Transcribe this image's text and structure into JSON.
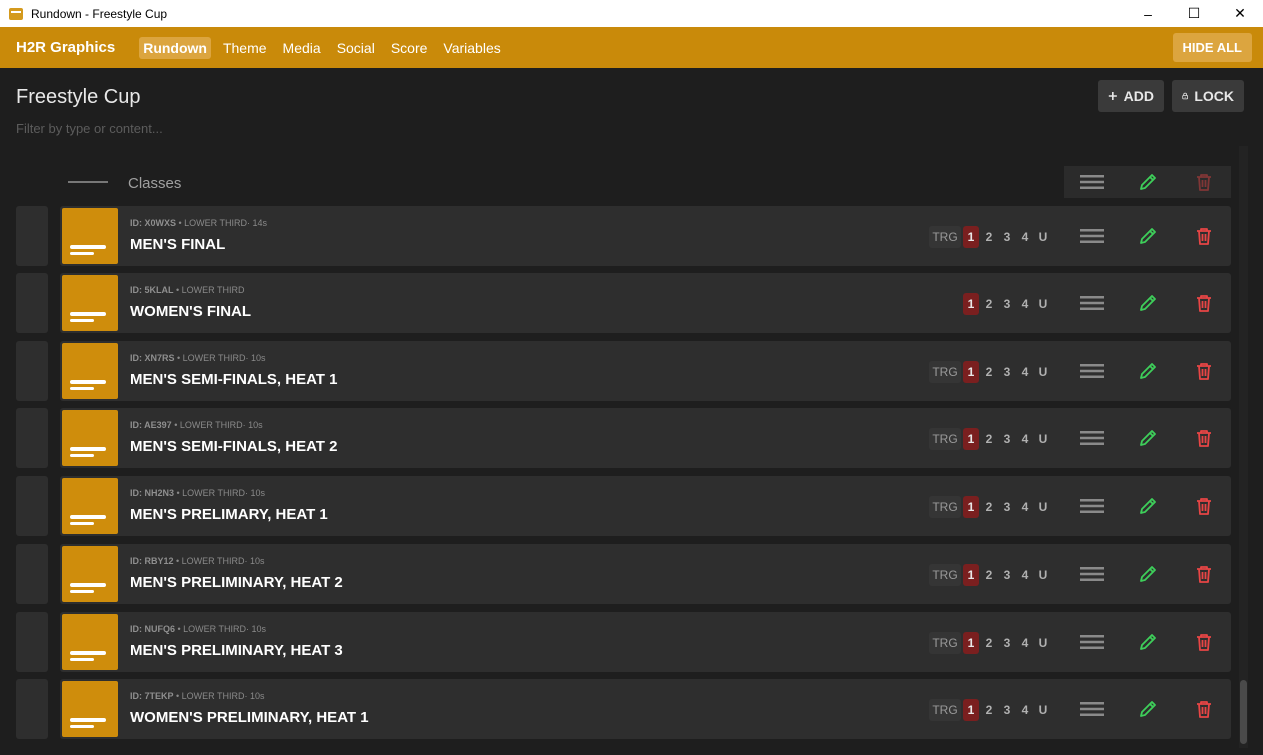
{
  "window": {
    "title": "Rundown - Freestyle Cup",
    "minimize": "–",
    "maximize": "☐",
    "close": "✕"
  },
  "nav": {
    "brand": "H2R Graphics",
    "items": [
      "Rundown",
      "Theme",
      "Media",
      "Social",
      "Score",
      "Variables"
    ],
    "active": "Rundown",
    "hide_all": "HIDE ALL"
  },
  "header": {
    "title": "Freestyle Cup",
    "filter_placeholder": "Filter by type or content...",
    "add_label": "ADD",
    "lock_label": "LOCK"
  },
  "divider": {
    "label": "Classes"
  },
  "colors": {
    "accent": "#c98a0a",
    "thumb": "#cf8d0c",
    "edit": "#3ecf5a",
    "delete": "#e84545",
    "channel_on": "#7a1f1f"
  },
  "channels": [
    "1",
    "2",
    "3",
    "4",
    "U"
  ],
  "trg_label": "TRG",
  "rows": [
    {
      "id": "ID: X0WXS",
      "meta": " • LOWER THIRD· 14s",
      "title": "MEN'S FINAL",
      "trg": true
    },
    {
      "id": "ID: 5KLAL",
      "meta": " • LOWER THIRD",
      "title": "WOMEN'S FINAL",
      "trg": false
    },
    {
      "id": "ID: XN7RS",
      "meta": " • LOWER THIRD· 10s",
      "title": "MEN'S SEMI-FINALS, HEAT 1",
      "trg": true
    },
    {
      "id": "ID: AE397",
      "meta": " • LOWER THIRD· 10s",
      "title": "MEN'S SEMI-FINALS, HEAT 2",
      "trg": true
    },
    {
      "id": "ID: NH2N3",
      "meta": " • LOWER THIRD· 10s",
      "title": "MEN'S PRELIMARY, HEAT 1",
      "trg": true
    },
    {
      "id": "ID: RBY12",
      "meta": " • LOWER THIRD· 10s",
      "title": "MEN'S PRELIMINARY, HEAT 2",
      "trg": true
    },
    {
      "id": "ID: NUFQ6",
      "meta": " • LOWER THIRD· 10s",
      "title": "MEN'S PRELIMINARY, HEAT 3",
      "trg": true
    },
    {
      "id": "ID: 7TEKP",
      "meta": " • LOWER THIRD· 10s",
      "title": "WOMEN'S PRELIMINARY, HEAT 1",
      "trg": true
    }
  ]
}
